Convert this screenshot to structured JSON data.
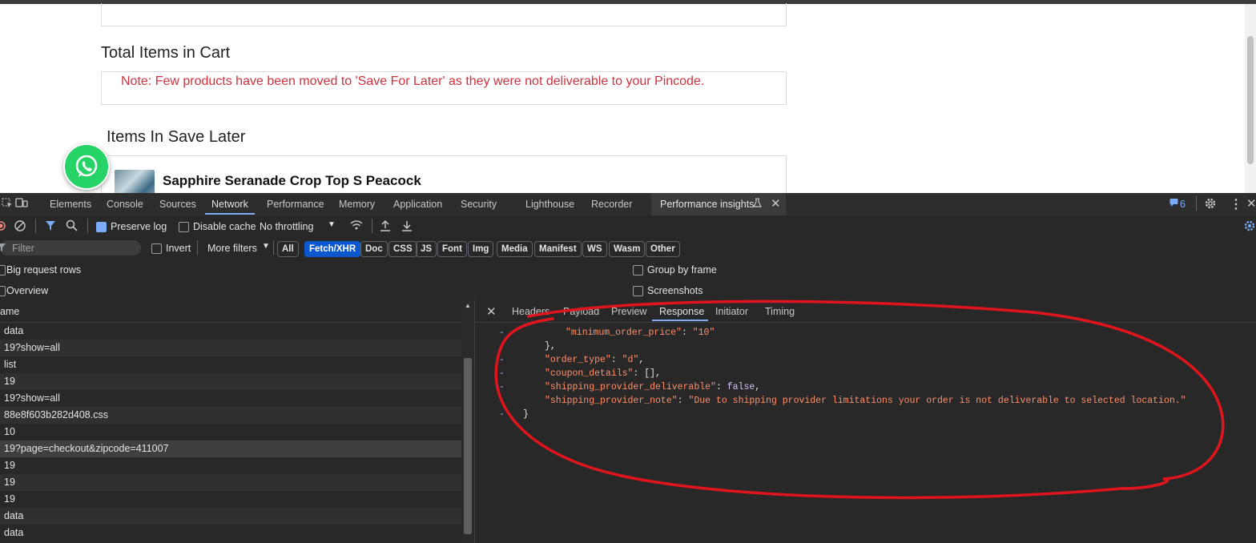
{
  "page": {
    "total_items_title": "Total Items in Cart",
    "note": "Note: Few products have been moved to 'Save For Later' as they were not deliverable to your Pincode.",
    "save_later_title": "Items In Save Later",
    "item_title": "Sapphire Seranade Crop Top S Peacock"
  },
  "devtools": {
    "tabs": [
      "Elements",
      "Console",
      "Sources",
      "Network",
      "Performance",
      "Memory",
      "Application",
      "Security",
      "Lighthouse",
      "Recorder",
      "Performance insights"
    ],
    "active_tab": "Network",
    "issues_count": "6",
    "toolbar": {
      "preserve_log": "Preserve log",
      "disable_cache": "Disable cache",
      "throttling": "No throttling"
    },
    "filter": {
      "placeholder": "Filter",
      "invert": "Invert",
      "more_filters": "More filters",
      "types": [
        "All",
        "Fetch/XHR",
        "Doc",
        "CSS",
        "JS",
        "Font",
        "Img",
        "Media",
        "Manifest",
        "WS",
        "Wasm",
        "Other"
      ],
      "active_type": "Fetch/XHR"
    },
    "options": {
      "big_request_rows": "Big request rows",
      "overview": "Overview",
      "group_by_frame": "Group by frame",
      "screenshots": "Screenshots"
    },
    "requests": {
      "column_name": "ame",
      "rows": [
        "data",
        "19?show=all",
        "list",
        "19",
        "19?show=all",
        "88e8f603b282d408.css",
        "10",
        "19?page=checkout&zipcode=411007",
        "19",
        "19",
        "19",
        "data",
        "data"
      ],
      "selected_index": 7
    },
    "detail": {
      "tabs": [
        "Headers",
        "Payload",
        "Preview",
        "Response",
        "Initiator",
        "Timing"
      ],
      "active_tab": "Response",
      "response": {
        "minimum_order_price_key": "\"minimum_order_price\"",
        "minimum_order_price_val": "\"10\"",
        "order_type_key": "\"order_type\"",
        "order_type_val": "\"d\"",
        "coupon_details_key": "\"coupon_details\"",
        "coupon_details_val": "[]",
        "shipping_provider_deliverable_key": "\"shipping_provider_deliverable\"",
        "shipping_provider_deliverable_val": "false",
        "shipping_provider_note_key": "\"shipping_provider_note\"",
        "shipping_provider_note_val": "\"Due to shipping provider limitations your order is not deliverable to selected location.\""
      }
    }
  },
  "colors": {
    "note_red": "#d0313c",
    "annotation_red": "#e0141c",
    "accent_blue": "#7cacf8",
    "json_key": "#ff8f6b"
  }
}
